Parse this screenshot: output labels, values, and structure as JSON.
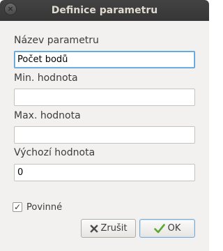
{
  "window": {
    "title": "Definice parametru",
    "close_glyph": "×"
  },
  "form": {
    "name_label": "Název parametru",
    "name_value": "Počet bodů",
    "min_label": "Min. hodnota",
    "min_value": "",
    "max_label": "Max. hodnota",
    "max_value": "",
    "default_label": "Výchozí hodnota",
    "default_value": "0",
    "required_label": "Povinné",
    "required_checked": true,
    "required_glyph": "✓"
  },
  "buttons": {
    "cancel_label": "Zrušit",
    "ok_label": "OK"
  },
  "colors": {
    "titlebar": "#3c3c3c",
    "window_bg": "#f2f1f0",
    "focus_border": "#4a9ad8",
    "ok_check": "#5aa832",
    "cancel_x": "#4a4a4a"
  },
  "icons": {
    "cancel": "close-icon",
    "ok": "checkmark-icon",
    "window_close": "window-close-icon"
  }
}
